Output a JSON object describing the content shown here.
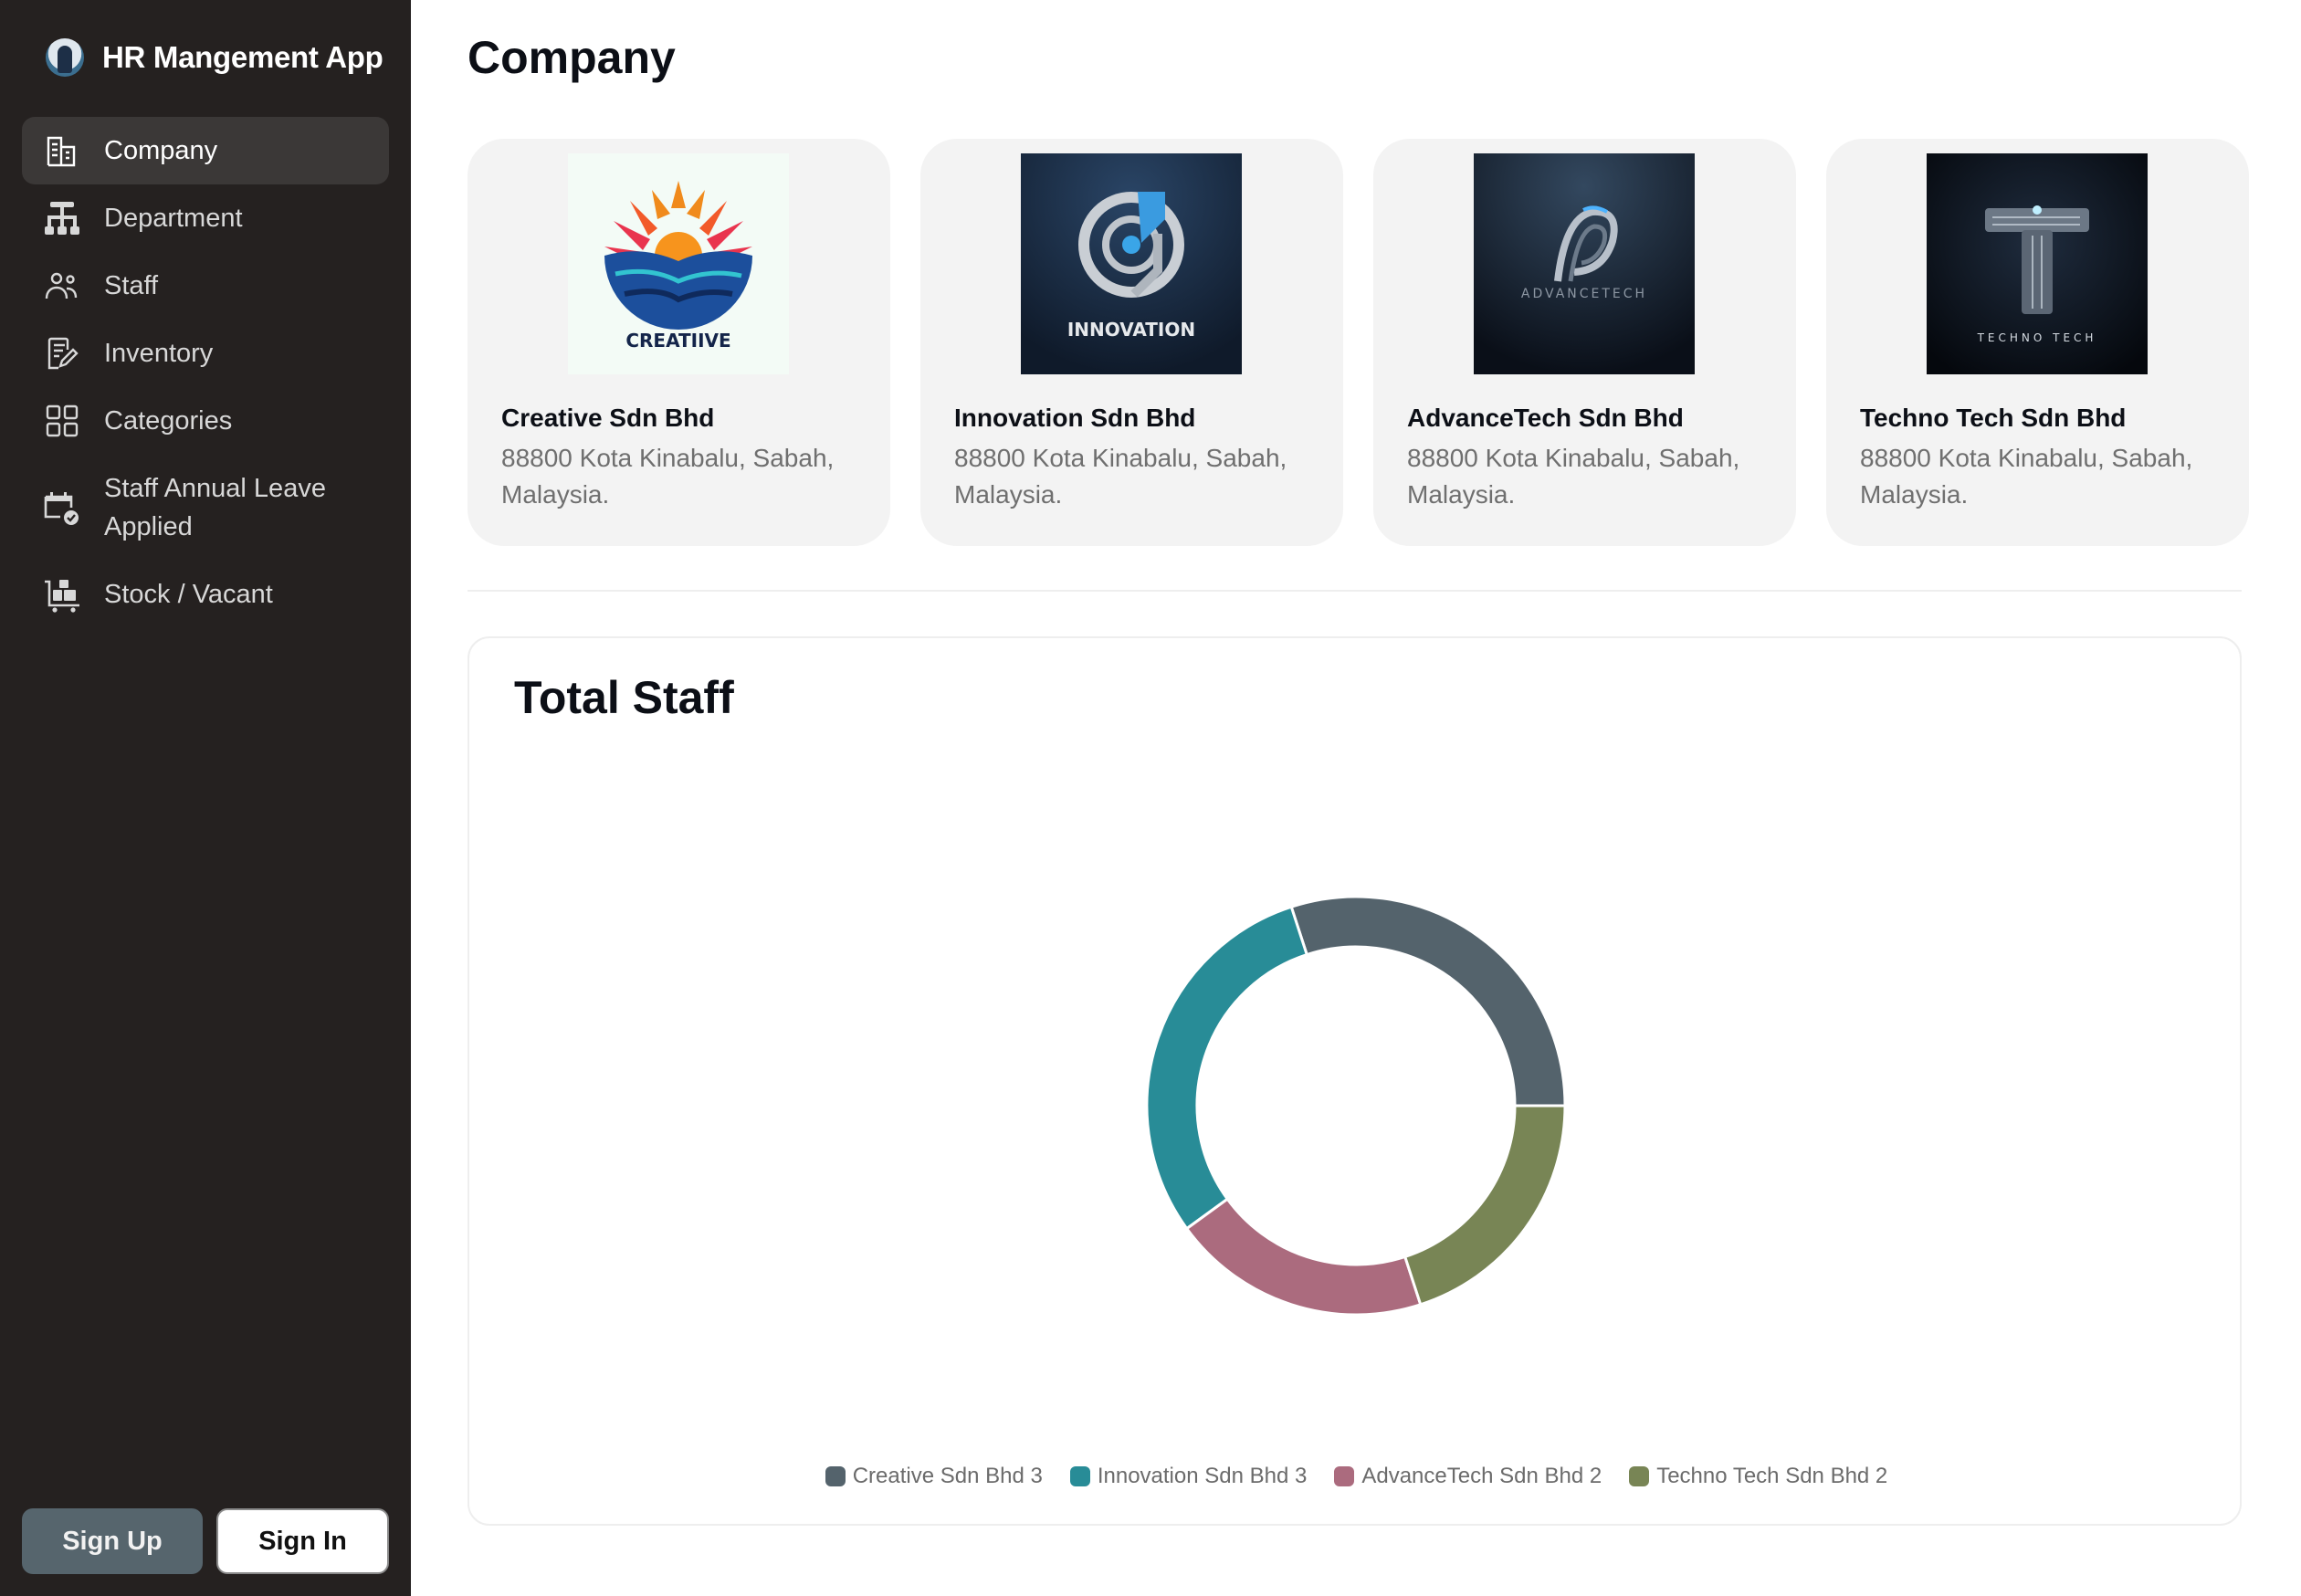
{
  "app": {
    "title": "HR Mangement App",
    "logo_icon": "hr-manager-avatar-icon"
  },
  "sidebar": {
    "items": [
      {
        "label": "Company",
        "icon": "building-icon",
        "active": true
      },
      {
        "label": "Department",
        "icon": "org-chart-icon",
        "active": false
      },
      {
        "label": "Staff",
        "icon": "users-icon",
        "active": false
      },
      {
        "label": "Inventory",
        "icon": "document-edit-icon",
        "active": false
      },
      {
        "label": "Categories",
        "icon": "grid-icon",
        "active": false
      },
      {
        "label": "Staff Annual Leave Applied",
        "icon": "calendar-check-icon",
        "active": false
      },
      {
        "label": "Stock / Vacant",
        "icon": "cart-boxes-icon",
        "active": false
      }
    ],
    "sign_up_label": "Sign Up",
    "sign_in_label": "Sign In"
  },
  "main": {
    "title": "Company",
    "companies": [
      {
        "name": "Creative Sdn Bhd",
        "address": "88800 Kota Kinabalu, Sabah, Malaysia.",
        "logo_text": "CREATIIVE"
      },
      {
        "name": "Innovation Sdn Bhd",
        "address": "88800 Kota Kinabalu, Sabah, Malaysia.",
        "logo_text": "INNOVATION"
      },
      {
        "name": "AdvanceTech Sdn Bhd",
        "address": "88800 Kota Kinabalu, Sabah, Malaysia.",
        "logo_text": "ADVANCETECH"
      },
      {
        "name": "Techno Tech Sdn Bhd",
        "address": "88800 Kota Kinabalu, Sabah, Malaysia.",
        "logo_text": "TECHNO TECH"
      }
    ]
  },
  "chart_data": {
    "type": "pie",
    "variant": "donut",
    "title": "Total Staff",
    "categories": [
      "Creative Sdn Bhd",
      "Innovation Sdn Bhd",
      "AdvanceTech Sdn Bhd",
      "Techno Tech Sdn Bhd"
    ],
    "values": [
      3,
      3,
      2,
      2
    ],
    "colors": [
      "#54636c",
      "#288c97",
      "#ab6b7e",
      "#788555"
    ],
    "legend_labels": [
      "Creative Sdn Bhd 3",
      "Innovation Sdn Bhd 3",
      "AdvanceTech Sdn Bhd 2",
      "Techno Tech Sdn Bhd 2"
    ],
    "legend_position": "bottom",
    "start_angle": "3 o'clock",
    "direction": "counterclockwise"
  }
}
